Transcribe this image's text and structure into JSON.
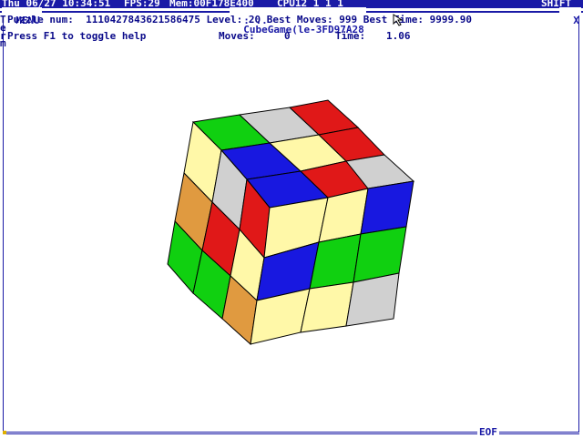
{
  "top_bar": {
    "datetime": "Thu 06/27 10:34:51",
    "fps": "FPS:29",
    "mem": "Mem:00F178E400",
    "cpu": "CPU12 1 1 1",
    "shift": "SHIFT"
  },
  "title_bar": {
    "menu_label": "MENU",
    "window_title": "CubeGame(le-3FD97A28",
    "close_label": "X"
  },
  "info": {
    "puzzle_line": "Puzzle num:  1110427843621586475 Level: 20 Best Moves: 999 Best Time: 9999.90",
    "help_line": "Press F1 to toggle help",
    "moves_label": "Moves:",
    "moves_value": "0",
    "time_label": "Time:",
    "time_value": "1.06",
    "side_letters": [
      "T",
      "e",
      "r",
      "m"
    ]
  },
  "status": {
    "eof_label": "EOF"
  },
  "colors": {
    "frame_blue": "#1a1aa6",
    "red": "#e01818",
    "green": "#10d010",
    "blue": "#1818e0",
    "yellow": "#fff8a8",
    "orange": "#e09a40",
    "white": "#d0d0d0"
  }
}
